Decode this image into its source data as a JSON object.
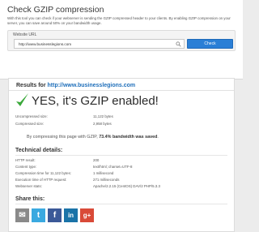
{
  "page": {
    "title": "Check GZIP compression",
    "intro": "With this tool you can check if your webserver is sending the GZIP compressed header to your clients. By enabling GZIP compression on your server, you can save around 50% on your bandwidth usage."
  },
  "form": {
    "label": "Website URL",
    "url_value": "http://www.businesslegions.com",
    "button_label": "Check"
  },
  "results": {
    "prefix": "Results for",
    "url": "http://www.businesslegions.com",
    "verdict": "YES, it's GZIP enabled!",
    "stats": [
      {
        "label": "Uncompressed size:",
        "value": "11,122 bytes"
      },
      {
        "label": "Compressed size:",
        "value": "2,958 bytes"
      }
    ],
    "saved_prefix": "By compressing this page with GZIP,",
    "saved_bold": "73.4% bandwidth was saved",
    "saved_suffix": "."
  },
  "technical": {
    "heading": "Technical details:",
    "rows": [
      {
        "label": "HTTP result:",
        "value": "200"
      },
      {
        "label": "Content type:",
        "value": "text/html; charset=UTF-8"
      },
      {
        "label": "Compression time for 11,122 bytes:",
        "value": "1 millisecond"
      },
      {
        "label": "Execution time of HTTP request:",
        "value": "271 milliseconds"
      },
      {
        "label": "Webserver stats:",
        "value": "Apache/2.2.15 (CentOS) DAV/2 PHP/5.3.3"
      }
    ]
  },
  "share": {
    "heading": "Share this:",
    "buttons": [
      {
        "name": "email",
        "glyph": "✉",
        "color": "#8a8a8a"
      },
      {
        "name": "twitter",
        "glyph": "t",
        "color": "#3aa9e0"
      },
      {
        "name": "facebook",
        "glyph": "f",
        "color": "#3b5998"
      },
      {
        "name": "linkedin",
        "glyph": "in",
        "color": "#1a73a8"
      },
      {
        "name": "google-plus",
        "glyph": "g+",
        "color": "#d94a38"
      }
    ]
  },
  "colors": {
    "accent": "#2a7fd6",
    "check": "#3aa83a",
    "link": "#1f6fba"
  }
}
